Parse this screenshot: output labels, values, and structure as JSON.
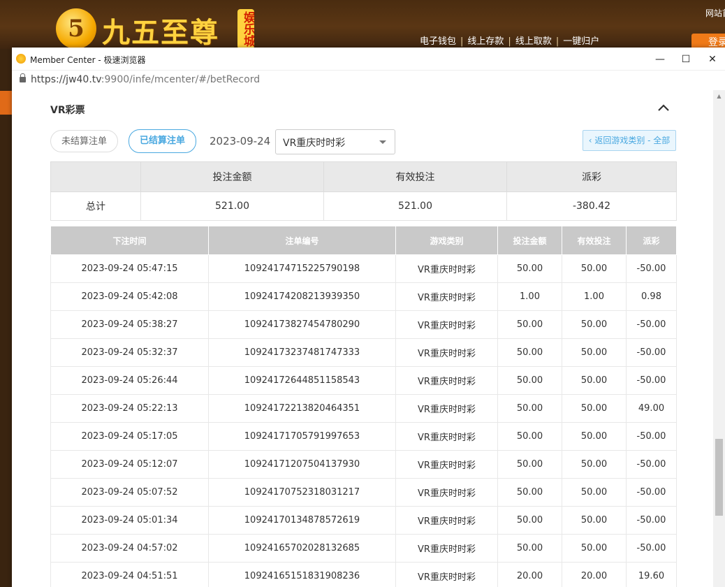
{
  "site": {
    "logo_numeral": "5",
    "logo_text": "九五至尊",
    "logo_badge": "娱乐城",
    "nav": [
      "电子钱包",
      "线上存款",
      "线上取款",
      "一键归户"
    ],
    "nav_separator": "|",
    "corner_note": "网站首",
    "login_label": "登录"
  },
  "window": {
    "title": "Member Center - 极速浏览器",
    "minimize_glyph": "—",
    "maximize_glyph": "☐",
    "close_glyph": "✕",
    "url_host": "https://jw40.tv",
    "url_rest": ":9900/infe/mcenter/#/betRecord"
  },
  "section": {
    "title": "VR彩票"
  },
  "filters": {
    "unsettled_label": "未结算注单",
    "settled_label": "已结算注单",
    "date": "2023-09-24",
    "game_selected": "VR重庆时时彩",
    "back_label": "‹ 返回游戏类别 - 全部"
  },
  "summary": {
    "headers": [
      "",
      "投注金额",
      "有效投注",
      "派彩"
    ],
    "label": "总计",
    "bet_total": "521.00",
    "valid_total": "521.00",
    "payout_total": "-380.42"
  },
  "records": {
    "headers": [
      "下注时间",
      "注单编号",
      "游戏类别",
      "投注金额",
      "有效投注",
      "派彩"
    ],
    "rows": [
      [
        "2023-09-24 05:47:15",
        "10924174715225790198",
        "VR重庆时时彩",
        "50.00",
        "50.00",
        "-50.00"
      ],
      [
        "2023-09-24 05:42:08",
        "10924174208213939350",
        "VR重庆时时彩",
        "1.00",
        "1.00",
        "0.98"
      ],
      [
        "2023-09-24 05:38:27",
        "10924173827454780290",
        "VR重庆时时彩",
        "50.00",
        "50.00",
        "-50.00"
      ],
      [
        "2023-09-24 05:32:37",
        "10924173237481747333",
        "VR重庆时时彩",
        "50.00",
        "50.00",
        "-50.00"
      ],
      [
        "2023-09-24 05:26:44",
        "10924172644851158543",
        "VR重庆时时彩",
        "50.00",
        "50.00",
        "-50.00"
      ],
      [
        "2023-09-24 05:22:13",
        "10924172213820464351",
        "VR重庆时时彩",
        "50.00",
        "50.00",
        "49.00"
      ],
      [
        "2023-09-24 05:17:05",
        "10924171705791997653",
        "VR重庆时时彩",
        "50.00",
        "50.00",
        "-50.00"
      ],
      [
        "2023-09-24 05:12:07",
        "10924171207504137930",
        "VR重庆时时彩",
        "50.00",
        "50.00",
        "-50.00"
      ],
      [
        "2023-09-24 05:07:52",
        "10924170752318031217",
        "VR重庆时时彩",
        "50.00",
        "50.00",
        "-50.00"
      ],
      [
        "2023-09-24 05:01:34",
        "10924170134878572619",
        "VR重庆时时彩",
        "50.00",
        "50.00",
        "-50.00"
      ],
      [
        "2023-09-24 04:57:02",
        "10924165702028132685",
        "VR重庆时时彩",
        "50.00",
        "50.00",
        "-50.00"
      ],
      [
        "2023-09-24 04:51:51",
        "10924165151831908236",
        "VR重庆时时彩",
        "20.00",
        "20.00",
        "19.60"
      ]
    ]
  },
  "colors": {
    "accent": "#49a8e0",
    "negative": "#e8434f",
    "header_gray": "#c9c9c9"
  }
}
